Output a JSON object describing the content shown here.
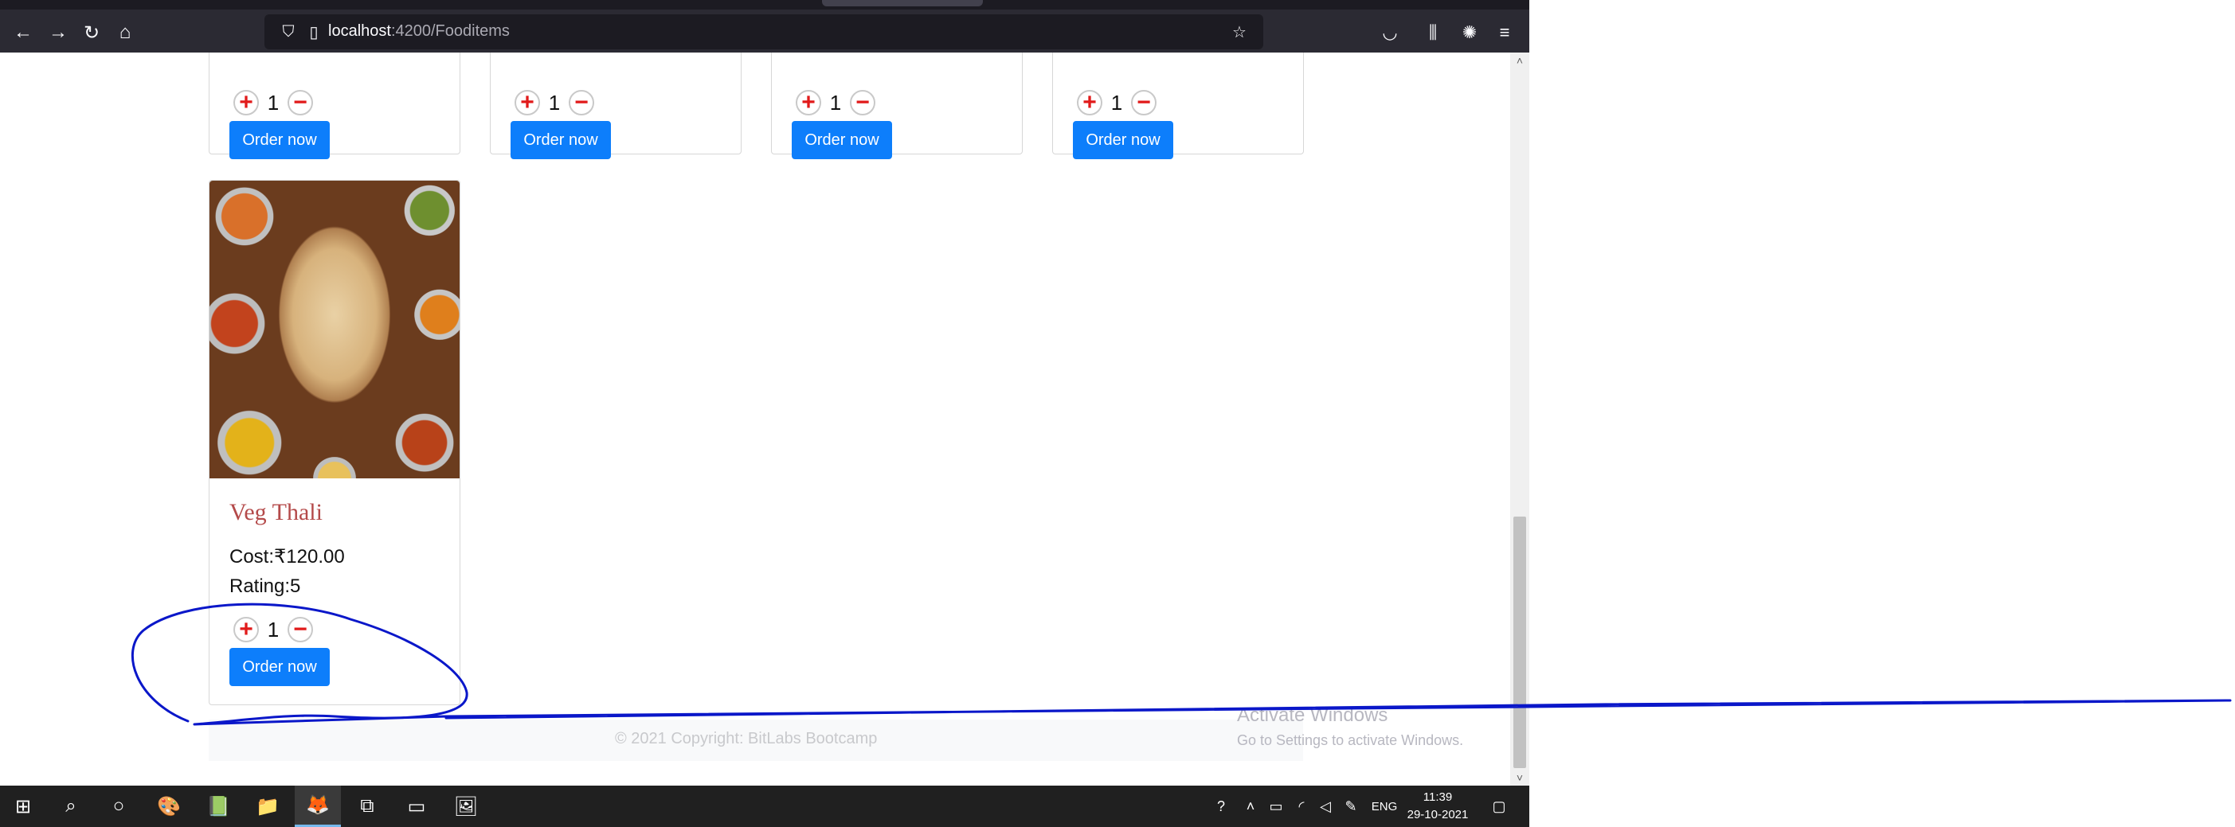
{
  "browser": {
    "url_host": "localhost",
    "url_path": ":4200/Fooditems",
    "icons": {
      "back": "back-arrow-icon",
      "forward": "forward-arrow-icon",
      "reload": "reload-icon",
      "home": "home-icon",
      "shield": "shield-icon",
      "page": "page-icon",
      "bookmark": "star-icon",
      "pocket": "pocket-icon",
      "library": "library-icon",
      "extensions": "extension-icon",
      "menu": "hamburger-menu-icon"
    }
  },
  "top_cards": [
    {
      "qty": "1",
      "order_label": "Order now"
    },
    {
      "qty": "1",
      "order_label": "Order now"
    },
    {
      "qty": "1",
      "order_label": "Order now"
    },
    {
      "qty": "1",
      "order_label": "Order now"
    }
  ],
  "food_card": {
    "title": "Veg Thali",
    "cost": "Cost:₹120.00",
    "rating": "Rating:5",
    "qty": "1",
    "order_label": "Order now"
  },
  "footer": {
    "text": "© 2021 Copyright: BitLabs Bootcamp"
  },
  "watermark": {
    "title": "Activate Windows",
    "subtitle": "Go to Settings to activate Windows."
  },
  "taskbar": {
    "language": "ENG",
    "time": "11:39",
    "date": "29-10-2021"
  },
  "colors": {
    "accent": "#0d7efb",
    "title": "#b44a4a",
    "plusminus": "#e11a1a",
    "annotation": "#0a17c9"
  }
}
